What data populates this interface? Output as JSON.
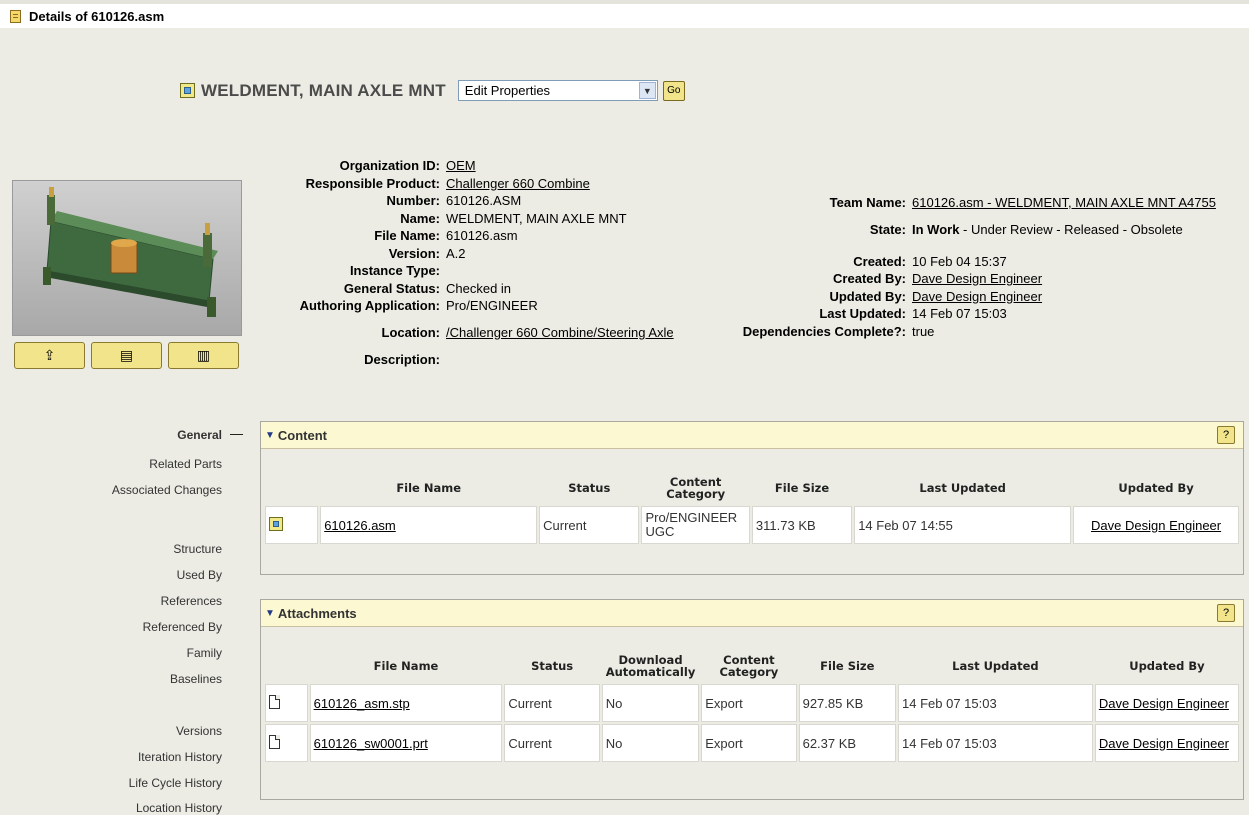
{
  "window": {
    "title": "Details of 610126.asm"
  },
  "header": {
    "part_title": "WELDMENT, MAIN AXLE MNT",
    "actions_selected": "Edit Properties",
    "go_label": "Go"
  },
  "attributes_left": [
    {
      "label": "Organization ID:",
      "value": "OEM",
      "link": true
    },
    {
      "label": "Responsible Product:",
      "value": "Challenger 660 Combine",
      "link": true
    },
    {
      "label": "Number:",
      "value": "610126.ASM",
      "link": false
    },
    {
      "label": "Name:",
      "value": "WELDMENT, MAIN AXLE MNT",
      "link": false
    },
    {
      "label": "File Name:",
      "value": "610126.asm",
      "link": false
    },
    {
      "label": "Version:",
      "value": "A.2",
      "link": false
    },
    {
      "label": "Instance Type:",
      "value": "",
      "link": false
    },
    {
      "label": "General Status:",
      "value": "Checked in",
      "link": false
    },
    {
      "label": "Authoring Application:",
      "value": "Pro/ENGINEER",
      "link": false
    },
    {
      "label": "Location:",
      "value": "/Challenger 660 Combine/Steering Axle",
      "link": true
    },
    {
      "label": "Description:",
      "value": "",
      "link": false
    }
  ],
  "attributes_right": {
    "team_label": "Team Name:",
    "team_value": "610126.asm - WELDMENT, MAIN AXLE MNT A4755",
    "state_label": "State:",
    "state_current": "In Work",
    "state_rest": " - Under Review - Released - Obsolete",
    "created_label": "Created:",
    "created_value": "10 Feb 04 15:37",
    "created_by_label": "Created By:",
    "created_by_value": "Dave Design Engineer",
    "updated_by_label": "Updated By:",
    "updated_by_value": "Dave Design Engineer",
    "last_updated_label": "Last Updated:",
    "last_updated_value": "14 Feb 07 15:03",
    "deps_label": "Dependencies Complete?:",
    "deps_value": "true"
  },
  "nav": {
    "general": "General",
    "items": [
      "Related Parts",
      "Associated Changes",
      "Structure",
      "Used By",
      "References",
      "Referenced By",
      "Family",
      "Baselines",
      "Versions",
      "Iteration History",
      "Life Cycle History",
      "Location History"
    ]
  },
  "content_panel": {
    "title": "Content",
    "help": "?",
    "headers": [
      "File Name",
      "Status",
      "Content Category",
      "File Size",
      "Last Updated",
      "Updated By"
    ],
    "rows": [
      {
        "file": "610126.asm",
        "status": "Current",
        "category": "Pro/ENGINEER UGC",
        "size": "311.73 KB",
        "updated": "14 Feb 07 14:55",
        "by": "Dave Design Engineer"
      }
    ]
  },
  "attachments_panel": {
    "title": "Attachments",
    "help": "?",
    "headers": [
      "File Name",
      "Status",
      "Download Automatically",
      "Content Category",
      "File Size",
      "Last Updated",
      "Updated By"
    ],
    "rows": [
      {
        "file": "610126_asm.stp",
        "status": "Current",
        "download": "No",
        "category": "Export",
        "size": "927.85 KB",
        "updated": "14 Feb 07 15:03",
        "by": "Dave Design Engineer"
      },
      {
        "file": "610126_sw0001.prt",
        "status": "Current",
        "download": "No",
        "category": "Export",
        "size": "62.37 KB",
        "updated": "14 Feb 07 15:03",
        "by": "Dave Design Engineer"
      }
    ]
  }
}
